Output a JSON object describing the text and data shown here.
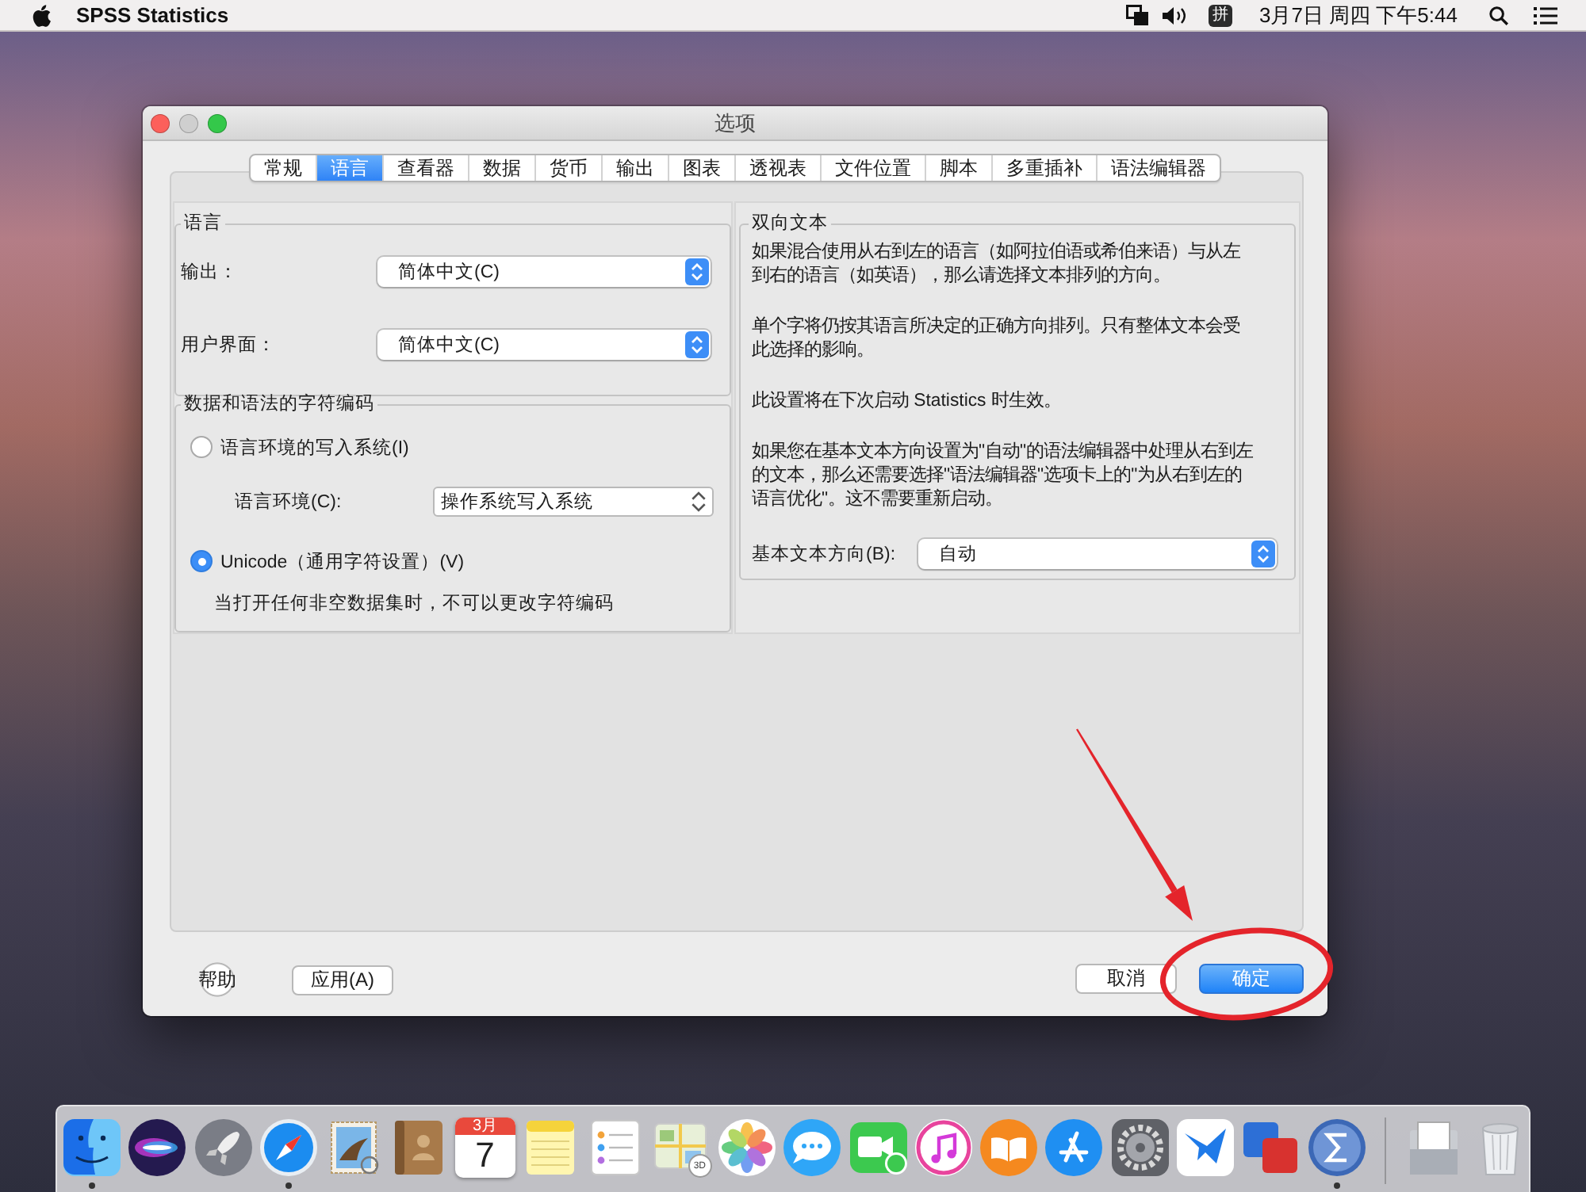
{
  "menu_bar": {
    "app_name": "SPSS Statistics",
    "input_method": "拼",
    "clock": "3月7日 周四 下午5:44"
  },
  "dialog": {
    "title": "选项",
    "window_buttons": [
      {
        "kind": "close",
        "disabled": false
      },
      {
        "kind": "minimize",
        "disabled": true
      },
      {
        "kind": "zoom",
        "disabled": false
      }
    ],
    "tabs": [
      {
        "label": "常规",
        "selected": false
      },
      {
        "label": "语言",
        "selected": true
      },
      {
        "label": "查看器",
        "selected": false
      },
      {
        "label": "数据",
        "selected": false
      },
      {
        "label": "货币",
        "selected": false
      },
      {
        "label": "输出",
        "selected": false
      },
      {
        "label": "图表",
        "selected": false
      },
      {
        "label": "透视表",
        "selected": false
      },
      {
        "label": "文件位置",
        "selected": false
      },
      {
        "label": "脚本",
        "selected": false
      },
      {
        "label": "多重插补",
        "selected": false
      },
      {
        "label": "语法编辑器",
        "selected": false
      }
    ],
    "language_group": {
      "title": "语言",
      "fields": [
        {
          "label": "输出：",
          "value": "简体中文(C)"
        },
        {
          "label": "用户界面：",
          "value": "简体中文(C)"
        }
      ]
    },
    "encoding_group": {
      "title": "数据和语法的字符编码",
      "options": [
        {
          "label": "语言环境的写入系统(I)",
          "selected": false
        },
        {
          "label": "Unicode（通用字符设置）(V)",
          "selected": true
        }
      ],
      "locale_field": {
        "label": "语言环境(C):",
        "value": "操作系统写入系统",
        "editable": true
      },
      "note": "当打开任何非空数据集时，不可以更改字符编码"
    },
    "bidi_group": {
      "title": "双向文本",
      "paragraphs": [
        "如果混合使用从右到左的语言（如阿拉伯语或希伯来语）与从左到右的语言（如英语），那么请选择文本排列的方向。",
        "单个字将仍按其语言所决定的正确方向排列。只有整体文本会受此选择的影响。",
        "此设置将在下次启动 Statistics 时生效。",
        "如果您在基本文本方向设置为\"自动\"的语法编辑器中处理从右到左的文本，那么还需要选择\"语法编辑器\"选项卡上的\"为从右到左的语言优化\"。这不需要重新启动。"
      ],
      "direction_field": {
        "label": "基本文本方向(B):",
        "value": "自动"
      }
    },
    "buttons_left": [
      {
        "label": "帮助",
        "kind": "help",
        "circled": false
      },
      {
        "label": "应用(A)",
        "kind": "normal",
        "circled": false
      }
    ],
    "buttons_right": [
      {
        "label": "取消",
        "kind": "normal",
        "circled": false
      },
      {
        "label": "确定",
        "kind": "default",
        "circled": true
      }
    ]
  },
  "dock": {
    "apps": [
      {
        "kind": "face",
        "running": true
      },
      {
        "kind": "orb",
        "running": false
      },
      {
        "kind": "rocket",
        "running": false
      },
      {
        "kind": "compass",
        "running": true
      },
      {
        "kind": "stamp",
        "running": false
      },
      {
        "kind": "address-book",
        "running": false
      },
      {
        "kind": "calendar",
        "running": false,
        "month": "3月",
        "day": "7"
      },
      {
        "kind": "notepad",
        "running": false
      },
      {
        "kind": "checklist",
        "running": false
      },
      {
        "kind": "map",
        "running": false,
        "badge": "3D"
      },
      {
        "kind": "flower",
        "running": false
      },
      {
        "kind": "speech-bubble",
        "running": false
      },
      {
        "kind": "video-camera",
        "running": false
      },
      {
        "kind": "music-note",
        "running": false
      },
      {
        "kind": "open-book",
        "running": false
      },
      {
        "kind": "a-shape",
        "running": false
      },
      {
        "kind": "gear",
        "running": false
      },
      {
        "kind": "bird",
        "running": false
      },
      {
        "kind": "overlapping-squares",
        "running": false
      },
      {
        "kind": "sigma",
        "running": true
      }
    ],
    "others": [
      {
        "kind": "paper-tray",
        "running": false
      },
      {
        "kind": "trash",
        "running": false
      }
    ]
  }
}
